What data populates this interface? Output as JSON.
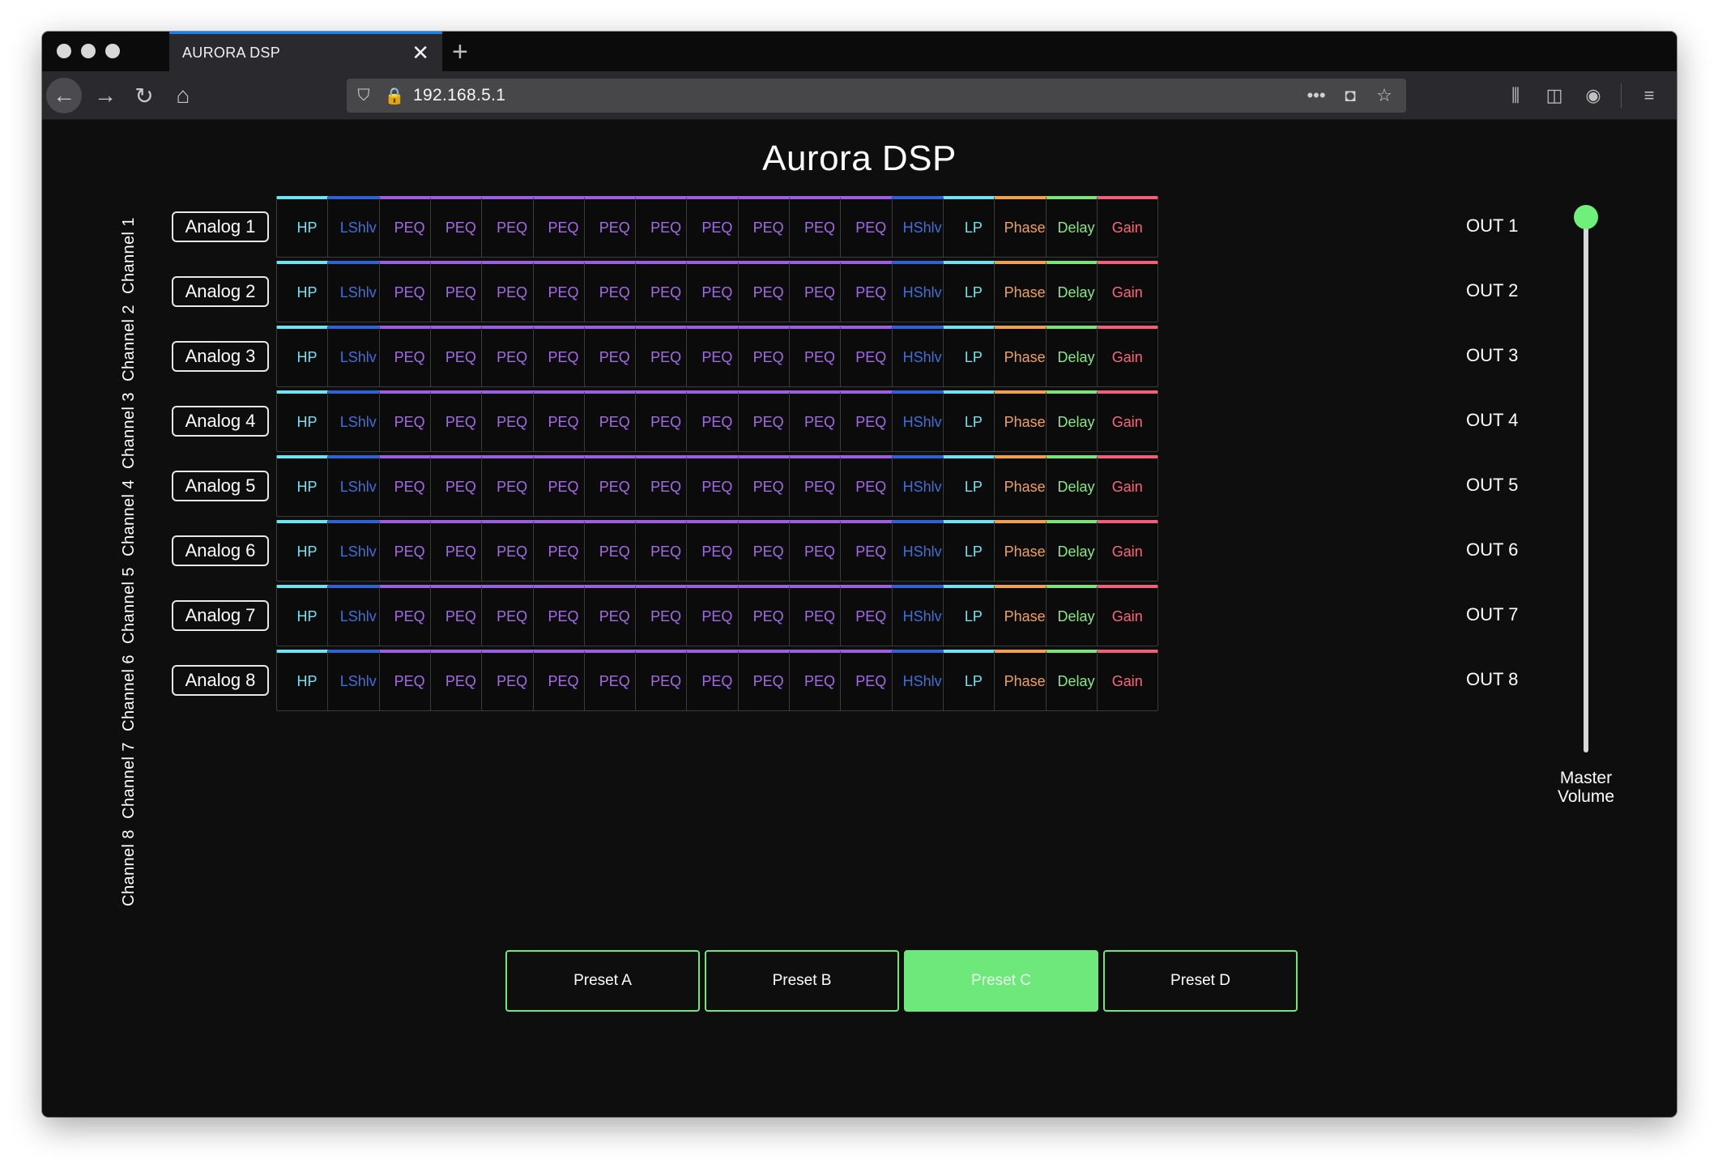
{
  "browser": {
    "tab_title": "AURORA DSP",
    "close_glyph": "✕",
    "new_tab_glyph": "+",
    "url": "192.168.5.1",
    "icons": {
      "back": "←",
      "forward": "→",
      "reload": "↻",
      "home": "⌂",
      "shield": "⛉",
      "insecure": "🔒",
      "more": "•••",
      "pocket": "◘",
      "bookmark": "☆",
      "library": "⫼",
      "sidebar": "◫",
      "account": "◉",
      "menu": "≡"
    }
  },
  "page": {
    "title": "Aurora DSP",
    "channels": [
      {
        "label": "Channel 1",
        "input": "Analog 1",
        "output": "OUT 1"
      },
      {
        "label": "Channel 2",
        "input": "Analog 2",
        "output": "OUT 2"
      },
      {
        "label": "Channel 3",
        "input": "Analog 3",
        "output": "OUT 3"
      },
      {
        "label": "Channel 4",
        "input": "Analog 4",
        "output": "OUT 4"
      },
      {
        "label": "Channel 5",
        "input": "Analog 5",
        "output": "OUT 5"
      },
      {
        "label": "Channel 6",
        "input": "Analog 6",
        "output": "OUT 6"
      },
      {
        "label": "Channel 7",
        "input": "Analog 7",
        "output": "OUT 7"
      },
      {
        "label": "Channel 8",
        "input": "Analog 8",
        "output": "OUT 8"
      }
    ],
    "blocks": [
      {
        "label": "HP",
        "kind": "hp"
      },
      {
        "label": "LShlv",
        "kind": "lshlv"
      },
      {
        "label": "PEQ",
        "kind": "peq"
      },
      {
        "label": "PEQ",
        "kind": "peq"
      },
      {
        "label": "PEQ",
        "kind": "peq"
      },
      {
        "label": "PEQ",
        "kind": "peq"
      },
      {
        "label": "PEQ",
        "kind": "peq"
      },
      {
        "label": "PEQ",
        "kind": "peq"
      },
      {
        "label": "PEQ",
        "kind": "peq"
      },
      {
        "label": "PEQ",
        "kind": "peq"
      },
      {
        "label": "PEQ",
        "kind": "peq"
      },
      {
        "label": "PEQ",
        "kind": "peq"
      },
      {
        "label": "HShlv",
        "kind": "hshlv"
      },
      {
        "label": "LP",
        "kind": "lp"
      },
      {
        "label": "Phase",
        "kind": "phase"
      },
      {
        "label": "Delay",
        "kind": "delay"
      },
      {
        "label": "Gain",
        "kind": "gain"
      }
    ],
    "block_colors": {
      "hp": "#6fe3f2",
      "lshlv": "#3c6fe0",
      "peq": "#a46be6",
      "hshlv": "#3c6fe0",
      "lp": "#6fe3f2",
      "phase": "#f2a258",
      "delay": "#8ae686",
      "gain": "#f06a82"
    },
    "master_volume": {
      "label_line1": "Master",
      "label_line2": "Volume",
      "level": 1.0
    },
    "presets": [
      {
        "label": "Preset A",
        "active": false
      },
      {
        "label": "Preset B",
        "active": false
      },
      {
        "label": "Preset C",
        "active": true
      },
      {
        "label": "Preset D",
        "active": false
      }
    ],
    "accent_color": "#6ee87a"
  }
}
